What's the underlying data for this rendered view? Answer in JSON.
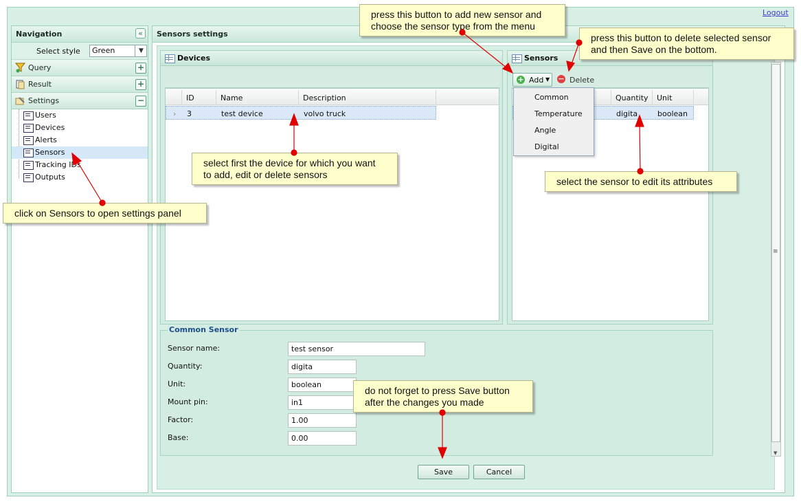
{
  "header": {
    "logout_label": "Logout"
  },
  "navigation": {
    "title": "Navigation",
    "select_style_label": "Select style",
    "select_style_value": "Green",
    "sections": [
      {
        "label": "Query",
        "icon": "funnel-icon",
        "toggle": "+"
      },
      {
        "label": "Result",
        "icon": "document-icon",
        "toggle": "+"
      },
      {
        "label": "Settings",
        "icon": "settings-icon",
        "toggle": "−"
      }
    ],
    "settings_items": [
      "Users",
      "Devices",
      "Alerts",
      "Sensors",
      "Tracking IDs",
      "Outputs"
    ],
    "selected_item": "Sensors"
  },
  "main": {
    "title": "Sensors settings",
    "devices": {
      "title": "Devices",
      "columns": [
        "ID",
        "Name",
        "Description"
      ],
      "rows": [
        {
          "id": "3",
          "name": "test device",
          "description": "volvo truck"
        }
      ]
    },
    "sensors": {
      "title": "Sensors",
      "add_label": "Add",
      "delete_label": "Delete",
      "columns": [
        "Quantity",
        "Unit"
      ],
      "rows": [
        {
          "quantity": "digita",
          "unit": "boolean"
        }
      ],
      "add_menu": [
        "Common",
        "Temperature",
        "Angle",
        "Digital"
      ]
    },
    "form": {
      "legend": "Common Sensor",
      "fields": [
        {
          "label": "Sensor name:",
          "value": "test sensor"
        },
        {
          "label": "Quantity:",
          "value": "digita"
        },
        {
          "label": "Unit:",
          "value": "boolean"
        },
        {
          "label": "Mount pin:",
          "value": "in1"
        },
        {
          "label": "Factor:",
          "value": "1.00"
        },
        {
          "label": "Base:",
          "value": "0.00"
        }
      ],
      "save_label": "Save",
      "cancel_label": "Cancel"
    }
  },
  "annotations": {
    "add_note": [
      "press this button to add new sensor and",
      "choose the sensor type from the menu"
    ],
    "delete_note": [
      "press this button to delete selected sensor",
      "and then Save on the bottom."
    ],
    "device_note": [
      "select first the device for which you want",
      "to add, edit or delete sensors"
    ],
    "sensor_note": "select the sensor to edit its attributes",
    "nav_note": "click on Sensors to open settings panel",
    "save_note": [
      "do not forget to press Save button",
      "after the changes you made"
    ]
  },
  "colors": {
    "panel_bg": "#d8efe5",
    "selection": "#d4e8f8",
    "arrow": "#e00000",
    "note_bg": "#ffffcc"
  }
}
